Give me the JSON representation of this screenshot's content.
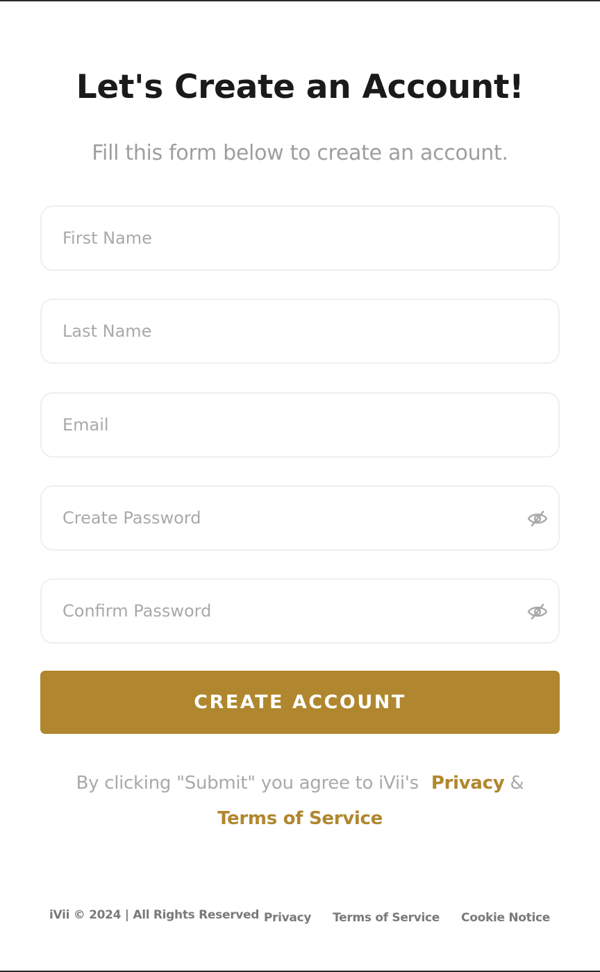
{
  "header": {
    "title": "Let's Create an Account!",
    "subtitle": "Fill this form below to create an account."
  },
  "form": {
    "first_name": {
      "placeholder": "First Name",
      "value": ""
    },
    "last_name": {
      "placeholder": "Last Name",
      "value": ""
    },
    "email": {
      "placeholder": "Email",
      "value": ""
    },
    "create_password": {
      "placeholder": "Create Password",
      "value": "",
      "icon": "eye-slash-icon"
    },
    "confirm_password": {
      "placeholder": "Confirm Password",
      "value": "",
      "icon": "eye-slash-icon"
    },
    "submit_label": "CREATE ACCOUNT"
  },
  "agreement": {
    "prefix": "By clicking \"Submit\" you agree to iVii's",
    "privacy_link": "Privacy",
    "conjunction": "&",
    "terms_link": "Terms of Service"
  },
  "footer": {
    "copyright": "iVii © 2024 | All Rights Reserved",
    "links": [
      "Privacy",
      "Terms of Service",
      "Cookie Notice"
    ]
  },
  "colors": {
    "accent": "#b0872e",
    "title": "#1a1a1a",
    "muted": "#9e9e9e",
    "field_border": "#efefef"
  }
}
